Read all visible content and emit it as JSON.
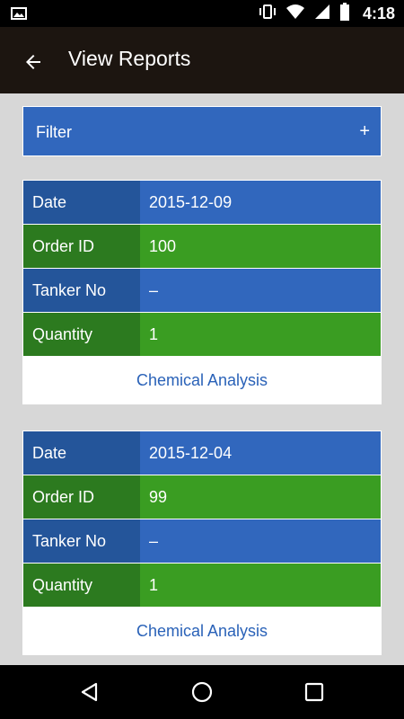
{
  "status_bar": {
    "time": "4:18",
    "icons": [
      "image-icon",
      "vibrate-icon",
      "wifi-icon",
      "cellular-icon",
      "battery-icon"
    ]
  },
  "app_bar": {
    "title": "View Reports",
    "back_icon": "arrow-back-icon"
  },
  "filter": {
    "label": "Filter",
    "toggle": "+"
  },
  "reports": [
    {
      "rows": [
        {
          "label": "Date",
          "value": "2015-12-09"
        },
        {
          "label": "Order ID",
          "value": "100"
        },
        {
          "label": "Tanker No",
          "value": "–"
        },
        {
          "label": "Quantity",
          "value": "1"
        }
      ],
      "action": "Chemical Analysis"
    },
    {
      "rows": [
        {
          "label": "Date",
          "value": "2015-12-04"
        },
        {
          "label": "Order ID",
          "value": "99"
        },
        {
          "label": "Tanker No",
          "value": "–"
        },
        {
          "label": "Quantity",
          "value": "1"
        }
      ],
      "action": "Chemical Analysis"
    }
  ],
  "nav_bar": {
    "buttons": [
      "back-triangle-icon",
      "home-circle-icon",
      "recents-square-icon"
    ]
  },
  "colors": {
    "row_blue_label": "#24559a",
    "row_blue_value": "#3167bd",
    "row_green_label": "#2c7a1f",
    "row_green_value": "#3a9d22",
    "link": "#2a62b8",
    "background": "#d7d7d7",
    "app_bar": "#1c1510"
  }
}
